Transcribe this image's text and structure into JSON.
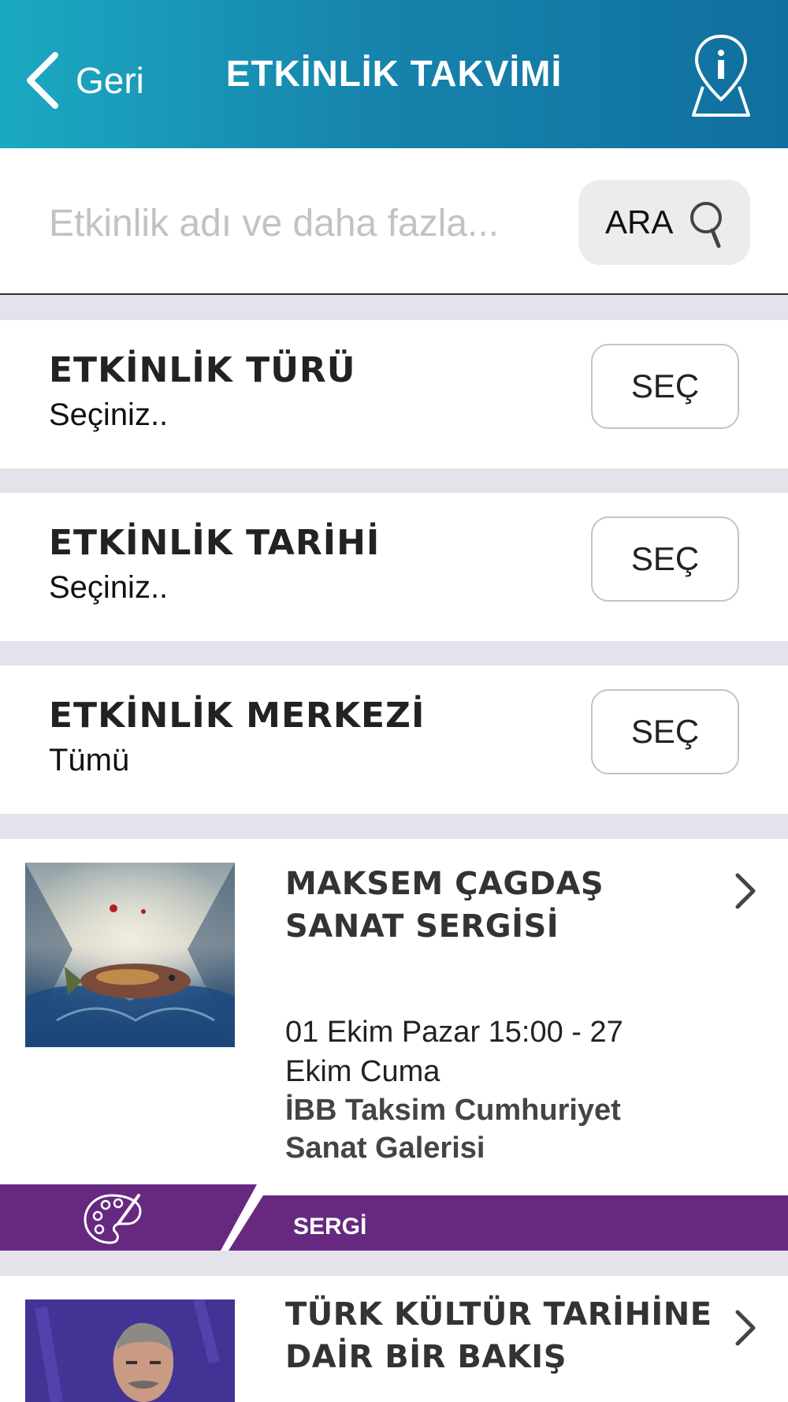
{
  "header": {
    "back_label": "Geri",
    "title": "ETKİNLİK TAKVİMİ",
    "info_icon": "map-pin-info-icon"
  },
  "search": {
    "placeholder": "Etkinlik adı ve daha fazla...",
    "value": "",
    "button_label": "ARA",
    "button_icon": "search-icon"
  },
  "filters": [
    {
      "title": "ETKİNLİK TÜRÜ",
      "value": "Seçiniz..",
      "button": "SEÇ"
    },
    {
      "title": "ETKİNLİK TARİHİ",
      "value": "Seçiniz..",
      "button": "SEÇ"
    },
    {
      "title": "ETKİNLİK MERKEZİ",
      "value": "Tümü",
      "button": "SEÇ"
    }
  ],
  "events": [
    {
      "title": "MAKSEM ÇAGDAŞ SANAT SERGİSİ",
      "date": "01 Ekim Pazar 15:00 - 27 Ekim Cuma",
      "venue": "İBB Taksim Cumhuriyet Sanat Galerisi",
      "category": "SERGİ",
      "category_icon": "palette-icon",
      "category_color": "#66297f"
    },
    {
      "title": "TÜRK KÜLTÜR TARİHİNE DAİR BİR BAKIŞ"
    }
  ],
  "colors": {
    "header_start": "#1ba9c1",
    "header_end": "#106fa0",
    "category_purple": "#66297f",
    "section_gap": "#e4e3ec"
  }
}
